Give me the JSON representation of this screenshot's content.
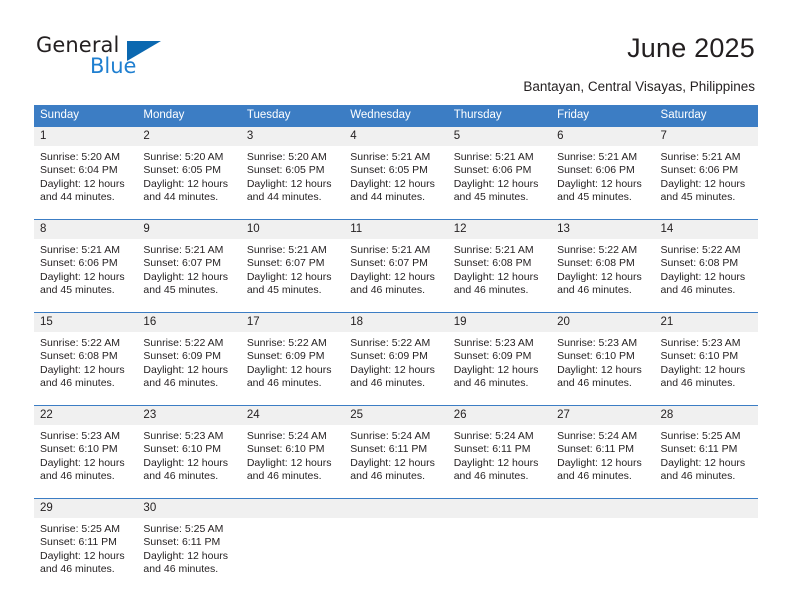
{
  "brand": {
    "name_top": "General",
    "name_bottom": "Blue",
    "accent_color": "#1f7fd0",
    "triangle_color": "#0b68b0"
  },
  "header": {
    "title": "June 2025",
    "subtitle": "Bantayan, Central Visayas, Philippines"
  },
  "calendar": {
    "header_bg": "#3c7dc4",
    "daynum_bg": "#f0f0f0",
    "weekdays": [
      "Sunday",
      "Monday",
      "Tuesday",
      "Wednesday",
      "Thursday",
      "Friday",
      "Saturday"
    ],
    "weeks": [
      [
        {
          "day": "1",
          "sunrise": "Sunrise: 5:20 AM",
          "sunset": "Sunset: 6:04 PM",
          "daylight": "Daylight: 12 hours and 44 minutes."
        },
        {
          "day": "2",
          "sunrise": "Sunrise: 5:20 AM",
          "sunset": "Sunset: 6:05 PM",
          "daylight": "Daylight: 12 hours and 44 minutes."
        },
        {
          "day": "3",
          "sunrise": "Sunrise: 5:20 AM",
          "sunset": "Sunset: 6:05 PM",
          "daylight": "Daylight: 12 hours and 44 minutes."
        },
        {
          "day": "4",
          "sunrise": "Sunrise: 5:21 AM",
          "sunset": "Sunset: 6:05 PM",
          "daylight": "Daylight: 12 hours and 44 minutes."
        },
        {
          "day": "5",
          "sunrise": "Sunrise: 5:21 AM",
          "sunset": "Sunset: 6:06 PM",
          "daylight": "Daylight: 12 hours and 45 minutes."
        },
        {
          "day": "6",
          "sunrise": "Sunrise: 5:21 AM",
          "sunset": "Sunset: 6:06 PM",
          "daylight": "Daylight: 12 hours and 45 minutes."
        },
        {
          "day": "7",
          "sunrise": "Sunrise: 5:21 AM",
          "sunset": "Sunset: 6:06 PM",
          "daylight": "Daylight: 12 hours and 45 minutes."
        }
      ],
      [
        {
          "day": "8",
          "sunrise": "Sunrise: 5:21 AM",
          "sunset": "Sunset: 6:06 PM",
          "daylight": "Daylight: 12 hours and 45 minutes."
        },
        {
          "day": "9",
          "sunrise": "Sunrise: 5:21 AM",
          "sunset": "Sunset: 6:07 PM",
          "daylight": "Daylight: 12 hours and 45 minutes."
        },
        {
          "day": "10",
          "sunrise": "Sunrise: 5:21 AM",
          "sunset": "Sunset: 6:07 PM",
          "daylight": "Daylight: 12 hours and 45 minutes."
        },
        {
          "day": "11",
          "sunrise": "Sunrise: 5:21 AM",
          "sunset": "Sunset: 6:07 PM",
          "daylight": "Daylight: 12 hours and 46 minutes."
        },
        {
          "day": "12",
          "sunrise": "Sunrise: 5:21 AM",
          "sunset": "Sunset: 6:08 PM",
          "daylight": "Daylight: 12 hours and 46 minutes."
        },
        {
          "day": "13",
          "sunrise": "Sunrise: 5:22 AM",
          "sunset": "Sunset: 6:08 PM",
          "daylight": "Daylight: 12 hours and 46 minutes."
        },
        {
          "day": "14",
          "sunrise": "Sunrise: 5:22 AM",
          "sunset": "Sunset: 6:08 PM",
          "daylight": "Daylight: 12 hours and 46 minutes."
        }
      ],
      [
        {
          "day": "15",
          "sunrise": "Sunrise: 5:22 AM",
          "sunset": "Sunset: 6:08 PM",
          "daylight": "Daylight: 12 hours and 46 minutes."
        },
        {
          "day": "16",
          "sunrise": "Sunrise: 5:22 AM",
          "sunset": "Sunset: 6:09 PM",
          "daylight": "Daylight: 12 hours and 46 minutes."
        },
        {
          "day": "17",
          "sunrise": "Sunrise: 5:22 AM",
          "sunset": "Sunset: 6:09 PM",
          "daylight": "Daylight: 12 hours and 46 minutes."
        },
        {
          "day": "18",
          "sunrise": "Sunrise: 5:22 AM",
          "sunset": "Sunset: 6:09 PM",
          "daylight": "Daylight: 12 hours and 46 minutes."
        },
        {
          "day": "19",
          "sunrise": "Sunrise: 5:23 AM",
          "sunset": "Sunset: 6:09 PM",
          "daylight": "Daylight: 12 hours and 46 minutes."
        },
        {
          "day": "20",
          "sunrise": "Sunrise: 5:23 AM",
          "sunset": "Sunset: 6:10 PM",
          "daylight": "Daylight: 12 hours and 46 minutes."
        },
        {
          "day": "21",
          "sunrise": "Sunrise: 5:23 AM",
          "sunset": "Sunset: 6:10 PM",
          "daylight": "Daylight: 12 hours and 46 minutes."
        }
      ],
      [
        {
          "day": "22",
          "sunrise": "Sunrise: 5:23 AM",
          "sunset": "Sunset: 6:10 PM",
          "daylight": "Daylight: 12 hours and 46 minutes."
        },
        {
          "day": "23",
          "sunrise": "Sunrise: 5:23 AM",
          "sunset": "Sunset: 6:10 PM",
          "daylight": "Daylight: 12 hours and 46 minutes."
        },
        {
          "day": "24",
          "sunrise": "Sunrise: 5:24 AM",
          "sunset": "Sunset: 6:10 PM",
          "daylight": "Daylight: 12 hours and 46 minutes."
        },
        {
          "day": "25",
          "sunrise": "Sunrise: 5:24 AM",
          "sunset": "Sunset: 6:11 PM",
          "daylight": "Daylight: 12 hours and 46 minutes."
        },
        {
          "day": "26",
          "sunrise": "Sunrise: 5:24 AM",
          "sunset": "Sunset: 6:11 PM",
          "daylight": "Daylight: 12 hours and 46 minutes."
        },
        {
          "day": "27",
          "sunrise": "Sunrise: 5:24 AM",
          "sunset": "Sunset: 6:11 PM",
          "daylight": "Daylight: 12 hours and 46 minutes."
        },
        {
          "day": "28",
          "sunrise": "Sunrise: 5:25 AM",
          "sunset": "Sunset: 6:11 PM",
          "daylight": "Daylight: 12 hours and 46 minutes."
        }
      ],
      [
        {
          "day": "29",
          "sunrise": "Sunrise: 5:25 AM",
          "sunset": "Sunset: 6:11 PM",
          "daylight": "Daylight: 12 hours and 46 minutes."
        },
        {
          "day": "30",
          "sunrise": "Sunrise: 5:25 AM",
          "sunset": "Sunset: 6:11 PM",
          "daylight": "Daylight: 12 hours and 46 minutes."
        },
        {
          "day": "",
          "sunrise": "",
          "sunset": "",
          "daylight": ""
        },
        {
          "day": "",
          "sunrise": "",
          "sunset": "",
          "daylight": ""
        },
        {
          "day": "",
          "sunrise": "",
          "sunset": "",
          "daylight": ""
        },
        {
          "day": "",
          "sunrise": "",
          "sunset": "",
          "daylight": ""
        },
        {
          "day": "",
          "sunrise": "",
          "sunset": "",
          "daylight": ""
        }
      ]
    ]
  }
}
